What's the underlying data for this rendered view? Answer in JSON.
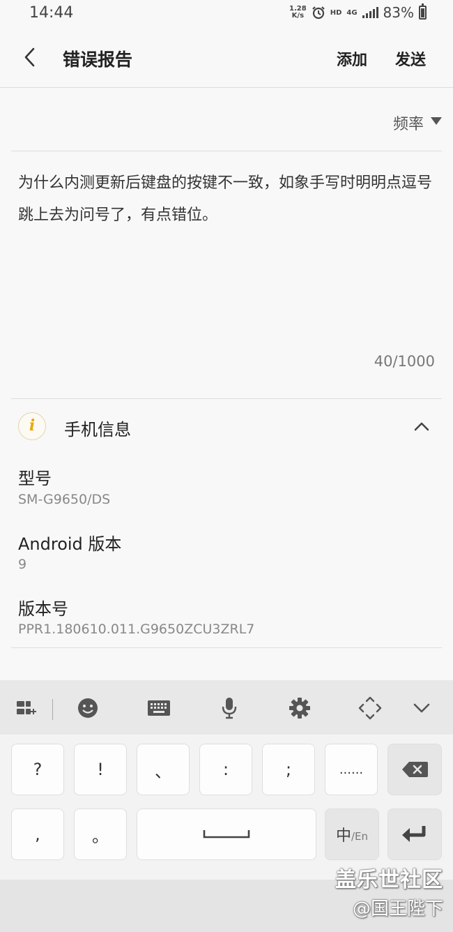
{
  "status": {
    "time": "14:44",
    "net_speed_value": "1.28",
    "net_speed_unit": "K/s",
    "hd": "HD",
    "network": "4G",
    "battery": "83%"
  },
  "app_bar": {
    "title": "错误报告",
    "add_label": "添加",
    "send_label": "发送"
  },
  "frequency": {
    "label": "频率"
  },
  "report": {
    "text": "为什么内测更新后键盘的按键不一致，如象手写时明明点逗号跳上去为问号了，有点错位。",
    "char_count": "40/1000"
  },
  "phone_info": {
    "title": "手机信息",
    "icon_letter": "i",
    "fields": [
      {
        "label": "型号",
        "value": "SM-G9650/DS"
      },
      {
        "label": "Android 版本",
        "value": "9"
      },
      {
        "label": "版本号",
        "value": "PPR1.180610.011.G9650ZCU3ZRL7"
      }
    ]
  },
  "keyboard": {
    "row1": [
      "?",
      "!",
      "、",
      ":",
      ";",
      "......"
    ],
    "row2": [
      ",",
      "。"
    ],
    "lang_main": "中",
    "lang_sub": "/En"
  },
  "watermark": {
    "line1": "盖乐世社区",
    "line2": "@国王陛下"
  }
}
